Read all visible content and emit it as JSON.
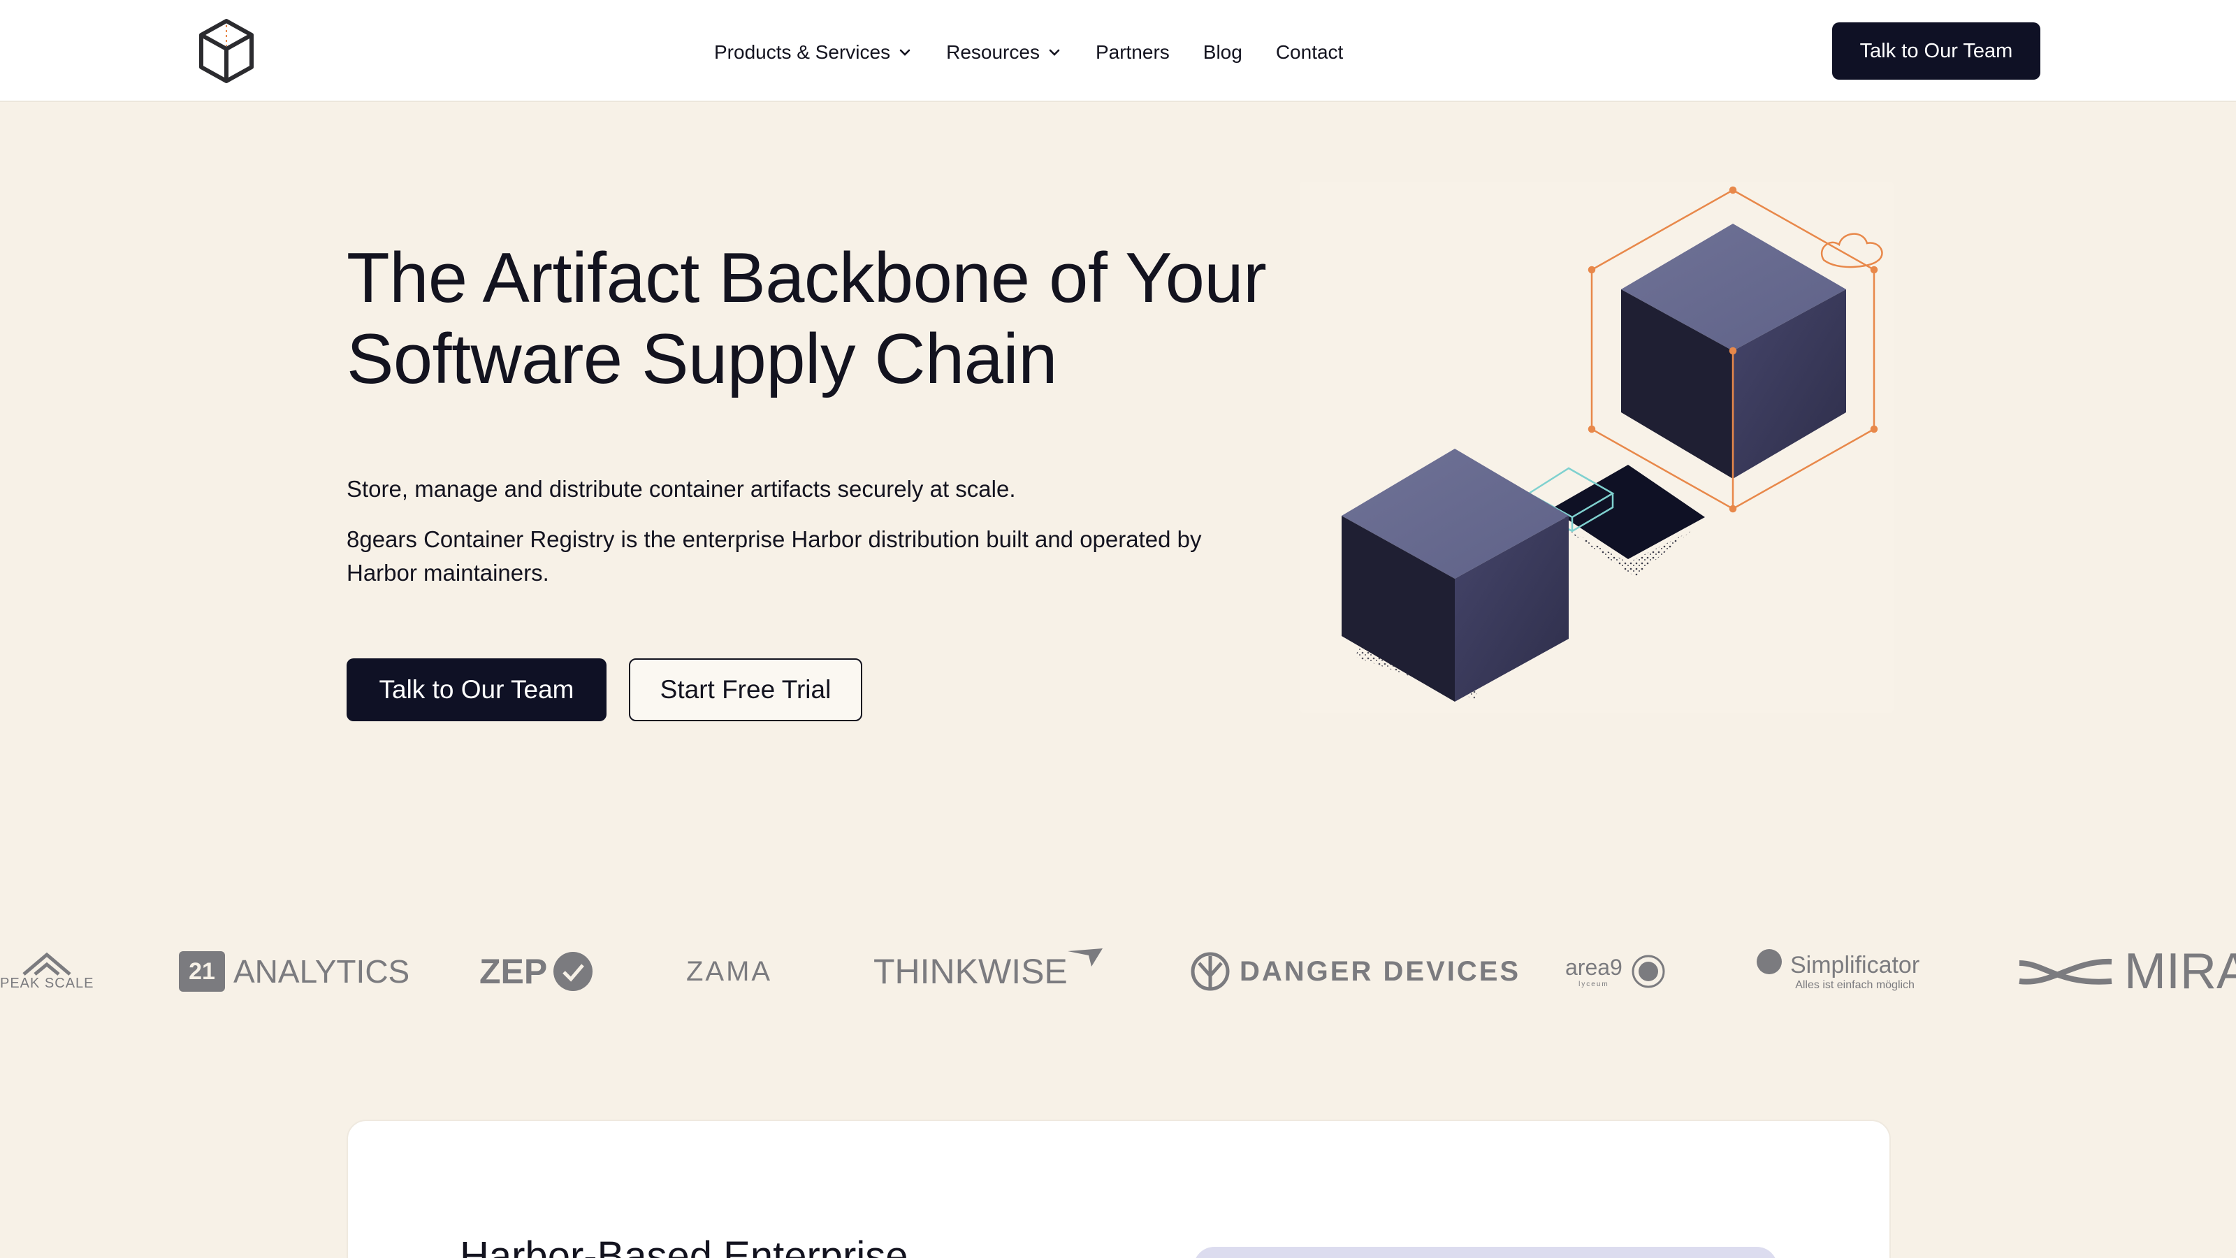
{
  "header": {
    "nav": [
      {
        "label": "Products & Services",
        "has_dropdown": true
      },
      {
        "label": "Resources",
        "has_dropdown": true
      },
      {
        "label": "Partners",
        "has_dropdown": false
      },
      {
        "label": "Blog",
        "has_dropdown": false
      },
      {
        "label": "Contact",
        "has_dropdown": false
      }
    ],
    "cta_label": "Talk to Our Team"
  },
  "hero": {
    "title": "The Artifact Backbone of Your Software Supply Chain",
    "subtitle": "Store, manage and distribute container artifacts securely at scale.",
    "description": "8gears Container Registry is the enterprise Harbor distribution built and operated by Harbor maintainers.",
    "primary_cta": "Talk to Our Team",
    "secondary_cta": "Start Free Trial"
  },
  "logos": {
    "items": [
      {
        "name": "PEAK SCALE"
      },
      {
        "name": "ANALYTICS",
        "badge": "21"
      },
      {
        "name": "ZEP"
      },
      {
        "name": "ZAMA"
      },
      {
        "name": "THINKWISE"
      },
      {
        "name": "DANGER DEVICES"
      },
      {
        "name": "area9",
        "tagline": "lyceum"
      },
      {
        "name": "Simplificator",
        "tagline": "Alles ist einfach möglich"
      },
      {
        "name": "MIRA"
      }
    ]
  },
  "card": {
    "title": "Harbor-Based Enterprise"
  },
  "colors": {
    "background": "#f7f1e7",
    "header_bg": "#ffffff",
    "primary_dark": "#0f1125",
    "cube_top": "#6a6d92",
    "cube_left": "#1f1f33",
    "cube_right": "#3b3b5c",
    "accent_orange": "#e8884a",
    "accent_teal": "#7fd1cf",
    "logo_gray": "#7b7b7f"
  }
}
